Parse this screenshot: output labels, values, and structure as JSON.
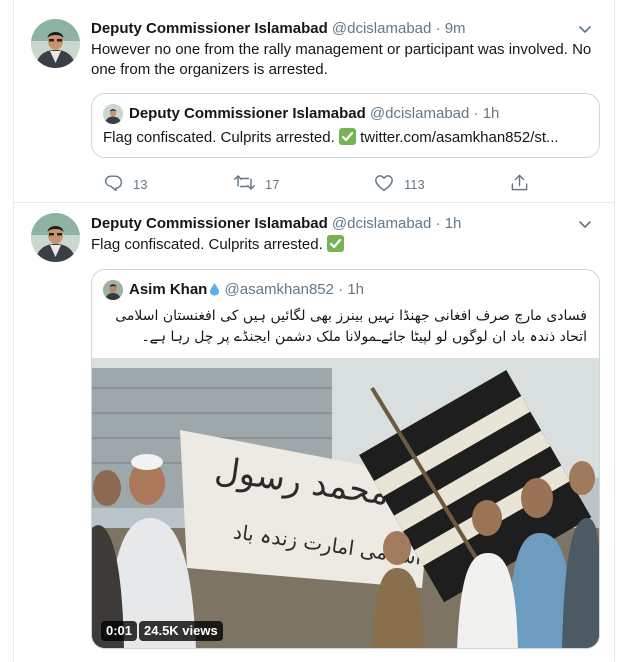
{
  "tweets": [
    {
      "author_name": "Deputy Commissioner Islamabad",
      "author_handle": "@dcislamabad",
      "time": "· 9m",
      "text": "However no one from the rally management or participant was involved. No one from the organizers is arrested.",
      "quote": {
        "author_name": "Deputy Commissioner Islamabad",
        "author_handle": "@dcislamabad",
        "time": "· 1h",
        "text": "Flag confiscated. Culprits arrested.",
        "link": "twitter.com/asamkhan852/st..."
      },
      "actions": {
        "replies": "13",
        "retweets": "17",
        "likes": "113"
      }
    },
    {
      "author_name": "Deputy Commissioner Islamabad",
      "author_handle": "@dcislamabad",
      "time": "· 1h",
      "text": "Flag confiscated. Culprits arrested.",
      "quote": {
        "author_name": "Asim Khan",
        "author_handle": "@asamkhan852",
        "time": "· 1h",
        "text": "فسادی مارچ صرف افغانی جھنڈا نہیں بینرز بھی لگائیں ہیں کی افغنستان اسلامی اتحاد ذندہ باد ان لوگوں لو لپیٹا جائےـمولانا ملک دشمن ایجنڈے پر چل رہا ہے۔",
        "video": {
          "duration": "0:01",
          "views": "24.5K views"
        }
      }
    }
  ],
  "icons": {
    "reply": "reply-icon",
    "retweet": "retweet-icon",
    "like": "heart-icon",
    "share": "share-icon",
    "menu": "chevron-down-icon",
    "check": "check-mark-emoji",
    "droplet": "droplet-emoji"
  },
  "colors": {
    "muted": "#657786",
    "border": "#e6ecf0",
    "check": "#77b255",
    "droplet": "#5dadec"
  }
}
